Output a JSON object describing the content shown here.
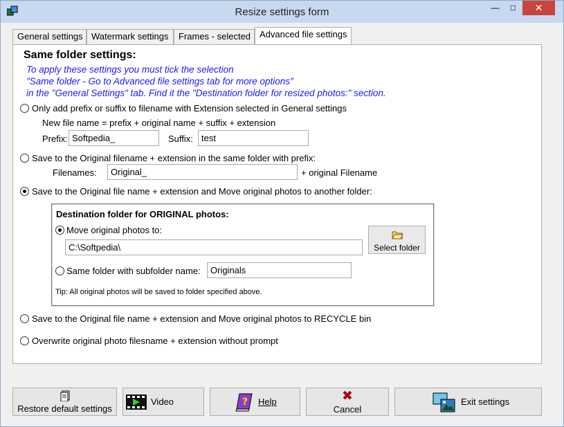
{
  "window": {
    "title": "Resize settings form",
    "minimize_icon": "minimize-icon",
    "maximize_icon": "maximize-icon",
    "close_icon": "close-icon"
  },
  "tabs": [
    {
      "label": "General settings"
    },
    {
      "label": "Watermark settings"
    },
    {
      "label": "Frames - selected"
    },
    {
      "label": "Advanced file settings",
      "active": true
    }
  ],
  "section": {
    "title": "Same folder settings:",
    "info_line1": "To apply these settings you must tick the selection",
    "info_line2": "\"Same folder - Go to  Advanced file settings tab for more options\"",
    "info_line3": "in the \"General Settings\" tab.  Find it the \"Destination folder for resized photos:\" section."
  },
  "options": {
    "opt1_label": "Only add prefix or suffix to filename with Extension selected in General settings",
    "opt1_desc": "New file name = prefix + original name + suffix + extension",
    "prefix_label": "Prefix:",
    "prefix_value": "Softpedia_",
    "suffix_label": "Suffix:",
    "suffix_value": "test",
    "opt2_label": "Save to the Original filename + extension  in the same folder with prefix:",
    "filenames_label": "Filenames:",
    "filenames_value": "Original_",
    "filenames_suffix": "+ original Filename",
    "opt3_label": "Save to the Original file name + extension and Move original photos to another folder:",
    "opt4_label": "Save to the Original file name + extension and Move original photos to RECYCLE bin",
    "opt5_label": "Overwrite original photo filesname + extension without prompt",
    "selected": 3
  },
  "destination": {
    "title": "Destination folder for ORIGINAL photos:",
    "move_label": "Move original photos to:",
    "move_path": "C:\\Softpedia\\",
    "select_folder_label": "Select folder",
    "same_folder_label": "Same folder with  subfolder name:",
    "subfolder_value": "Originals",
    "tip": "Tip: All original photos will be saved to folder specified above.",
    "selected": "move"
  },
  "buttons": {
    "restore": "Restore default settings",
    "video": "Video",
    "help": "Help",
    "cancel": "Cancel",
    "exit": "Exit settings"
  }
}
